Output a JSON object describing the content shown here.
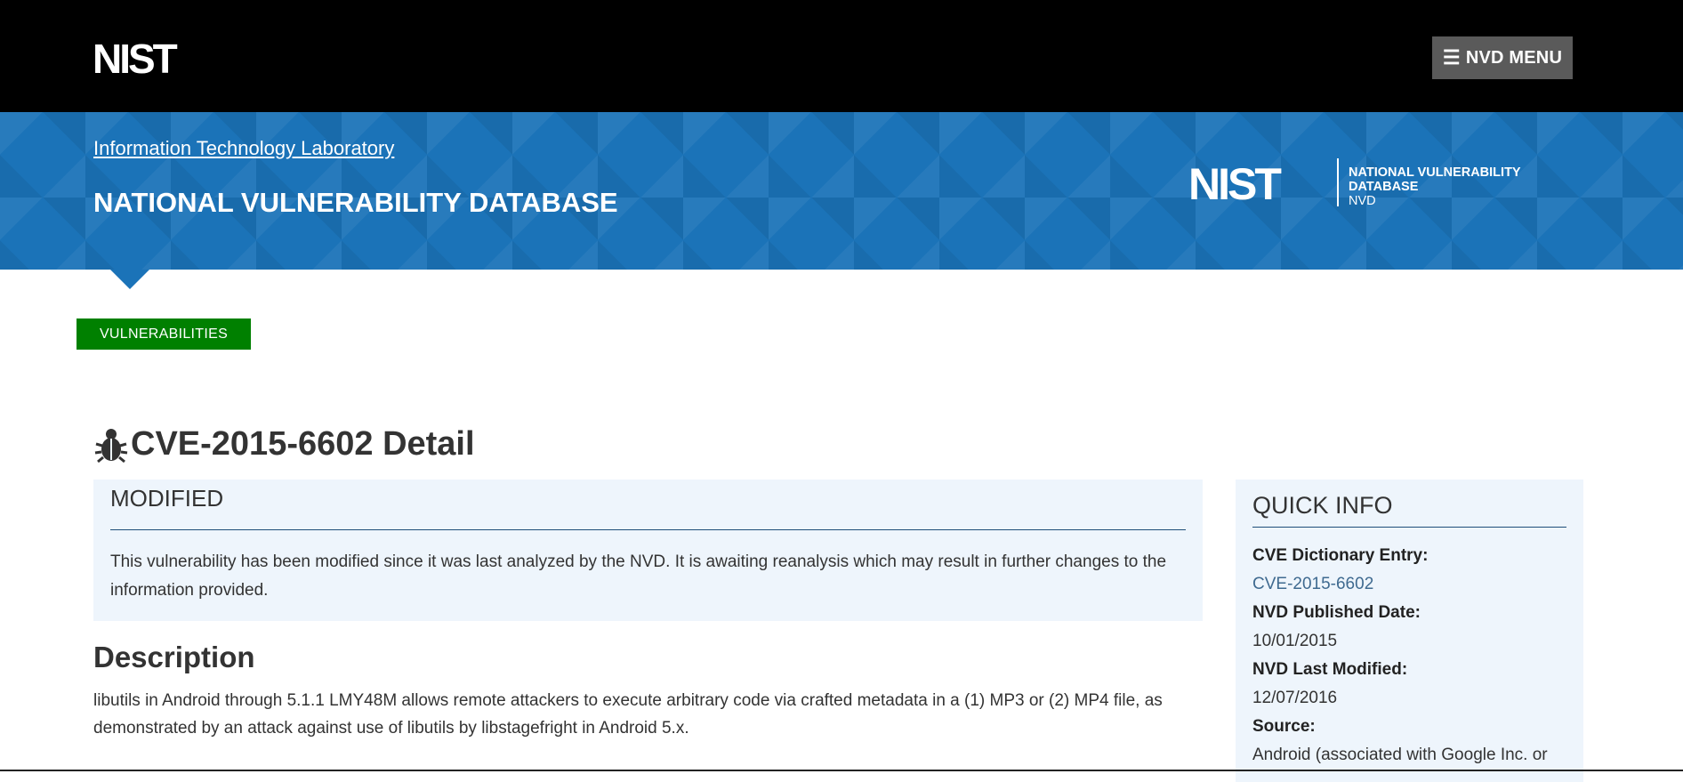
{
  "header": {
    "logo": "NIST",
    "menu_icon": "hamburger-icon",
    "menu_label": "NVD MENU"
  },
  "banner": {
    "lab_link": "Information Technology Laboratory",
    "title": "NATIONAL VULNERABILITY DATABASE",
    "nvd_logo": {
      "mark": "NIST",
      "line1": "NATIONAL VULNERABILITY",
      "line2": "DATABASE",
      "line3": "NVD"
    },
    "background_color": "#1b73b8"
  },
  "nav": {
    "active_tab": "VULNERABILITIES",
    "active_color": "#008000"
  },
  "page": {
    "title_icon": "bug-icon",
    "title": "CVE-2015-6602 Detail"
  },
  "modified": {
    "heading": "MODIFIED",
    "text": "This vulnerability has been modified since it was last analyzed by the NVD. It is awaiting reanalysis which may result in further changes to the information provided."
  },
  "description": {
    "heading": "Description",
    "text": "libutils in Android through 5.1.1 LMY48M allows remote attackers to execute arbitrary code via crafted metadata in a (1) MP3 or (2) MP4 file, as demonstrated by an attack against use of libutils by libstagefright in Android 5.x."
  },
  "quick_info": {
    "heading": "QUICK INFO",
    "cve_label": "CVE Dictionary Entry:",
    "cve_value": "CVE-2015-6602",
    "published_label": "NVD Published Date:",
    "published_value": "10/01/2015",
    "modified_label": "NVD Last Modified:",
    "modified_value": "12/07/2016",
    "source_label": "Source:",
    "source_value": "Android (associated with Google Inc. or"
  }
}
